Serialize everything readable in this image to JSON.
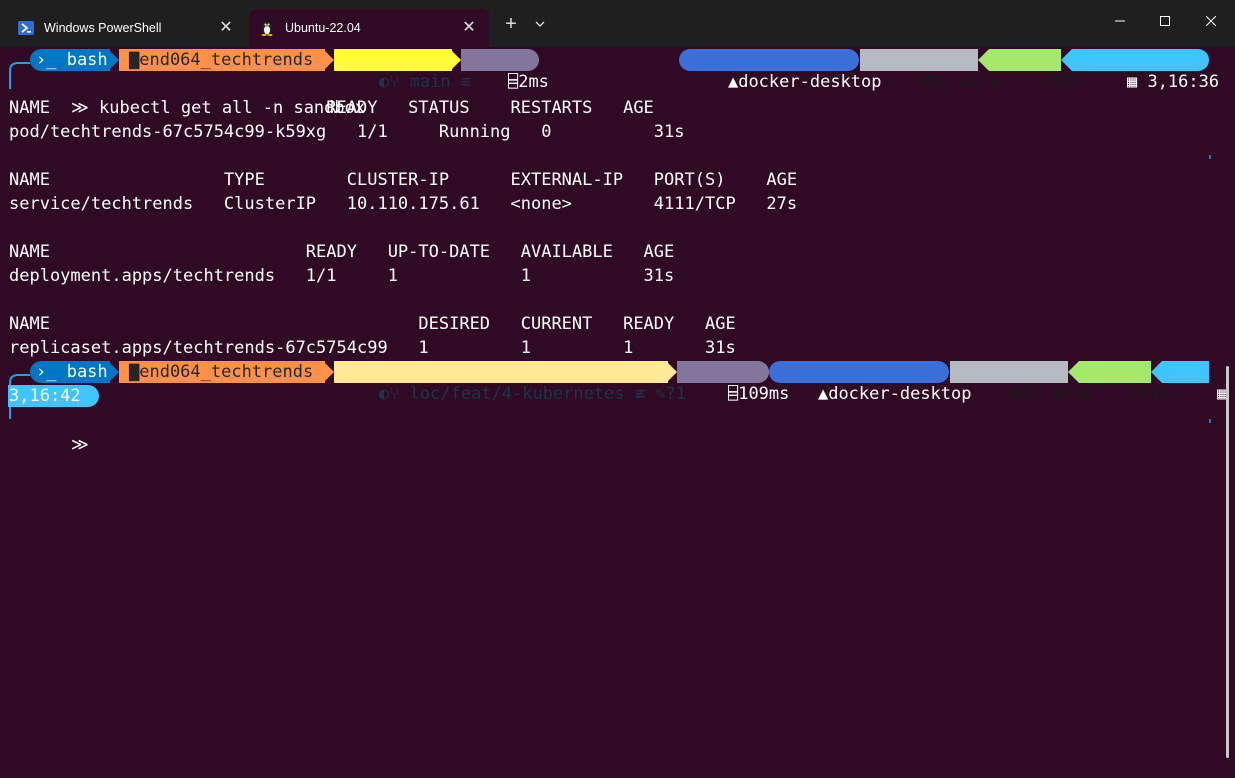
{
  "tabs": [
    {
      "label": "Windows PowerShell",
      "icon": "powershell-icon"
    },
    {
      "label": "Ubuntu-22.04",
      "icon": "linux-tux-icon"
    }
  ],
  "tabbar": {
    "new_tab": "+",
    "dropdown": "⌄"
  },
  "window_controls": {
    "minimize": "—",
    "maximize": "☐",
    "close": "✕"
  },
  "colors": {
    "terminal_bg": "#300a24",
    "bash_seg": "#0077c2",
    "path_seg": "#ff9248",
    "git_seg": "#fffb38",
    "git_seg_dirty": "#ffeb95",
    "exec_seg": "#83769c",
    "docker_seg": "#3a6fd8",
    "wsl_seg": "#b6bac2",
    "battery_seg": "#a6e86a",
    "time_seg": "#40c4ff"
  },
  "prompt1": {
    "shell": "›_ bash",
    "path": "▇end064_techtrends",
    "git": " main ≡",
    "exec_time": "2ms",
    "docker": "docker-desktop",
    "wsl": "WSL at ",
    "battery": "38%",
    "time": " 3,16:36",
    "command": "kubectl get all -n sandbox"
  },
  "output": [
    "NAME                           READY   STATUS    RESTARTS   AGE",
    "pod/techtrends-67c5754c99-k59xg   1/1     Running   0          31s",
    "",
    "NAME                 TYPE        CLUSTER-IP      EXTERNAL-IP   PORT(S)    AGE",
    "service/techtrends   ClusterIP   10.110.175.61   <none>        4111/TCP   27s",
    "",
    "NAME                         READY   UP-TO-DATE   AVAILABLE   AGE",
    "deployment.apps/techtrends   1/1     1            1           31s",
    "",
    "NAME                                    DESIRED   CURRENT   READY   AGE",
    "replicaset.apps/techtrends-67c5754c99   1         1         1       31s"
  ],
  "prompt2": {
    "shell": "›_ bash",
    "path": "▇end064_techtrends",
    "git": " loc/feat/4-kubernetes ≢ ✎?1",
    "exec_time": "109ms",
    "docker": "docker-desktop",
    "wsl": "WSL at ",
    "battery": "44%",
    "time_wrapped": "3,16:42"
  }
}
